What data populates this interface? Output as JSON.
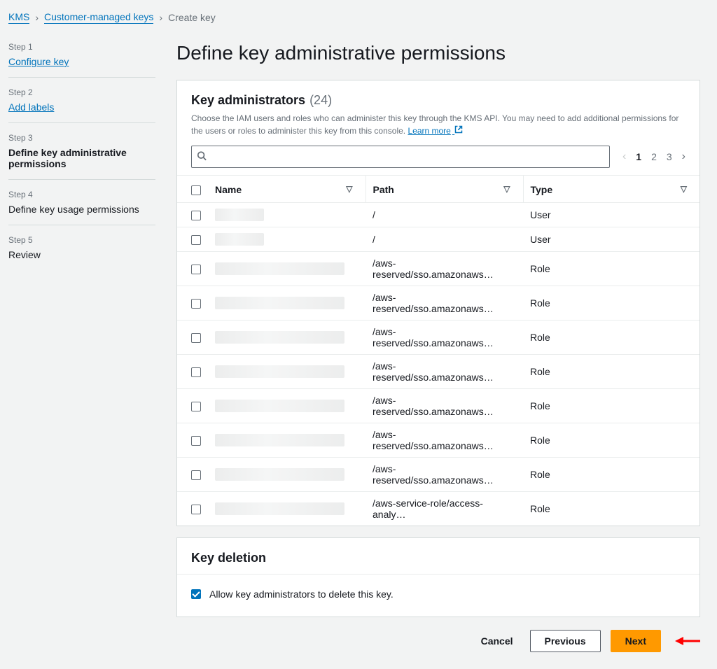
{
  "breadcrumbs": {
    "items": [
      {
        "label": "KMS",
        "link": true
      },
      {
        "label": "Customer-managed keys",
        "link": true
      },
      {
        "label": "Create key",
        "link": false
      }
    ]
  },
  "wizard_steps": [
    {
      "step": "Step 1",
      "title": "Configure key",
      "state": "link"
    },
    {
      "step": "Step 2",
      "title": "Add labels",
      "state": "link"
    },
    {
      "step": "Step 3",
      "title": "Define key administrative permissions",
      "state": "current"
    },
    {
      "step": "Step 4",
      "title": "Define key usage permissions",
      "state": "future"
    },
    {
      "step": "Step 5",
      "title": "Review",
      "state": "future"
    }
  ],
  "page_title": "Define key administrative permissions",
  "admins_panel": {
    "title": "Key administrators",
    "count": "(24)",
    "description": "Choose the IAM users and roles who can administer this key through the KMS API. You may need to add additional permissions for the users or roles to administer this key from this console.",
    "learn_more": "Learn more",
    "search_placeholder": "",
    "pagination": {
      "pages": [
        "1",
        "2",
        "3"
      ],
      "current": "1"
    },
    "columns": {
      "name": "Name",
      "path": "Path",
      "type": "Type"
    },
    "rows": [
      {
        "name_blur": "s",
        "path": "/",
        "type": "User"
      },
      {
        "name_blur": "s",
        "path": "/",
        "type": "User"
      },
      {
        "name_blur": "l",
        "path": "/aws-reserved/sso.amazonaws…",
        "type": "Role"
      },
      {
        "name_blur": "l",
        "path": "/aws-reserved/sso.amazonaws…",
        "type": "Role"
      },
      {
        "name_blur": "l",
        "path": "/aws-reserved/sso.amazonaws…",
        "type": "Role"
      },
      {
        "name_blur": "l",
        "path": "/aws-reserved/sso.amazonaws…",
        "type": "Role"
      },
      {
        "name_blur": "l",
        "path": "/aws-reserved/sso.amazonaws…",
        "type": "Role"
      },
      {
        "name_blur": "l",
        "path": "/aws-reserved/sso.amazonaws…",
        "type": "Role"
      },
      {
        "name_blur": "l",
        "path": "/aws-reserved/sso.amazonaws…",
        "type": "Role"
      },
      {
        "name_blur": "l",
        "path": "/aws-service-role/access-analy…",
        "type": "Role"
      }
    ]
  },
  "deletion_panel": {
    "title": "Key deletion",
    "checkbox_label": "Allow key administrators to delete this key.",
    "checked": true
  },
  "footer": {
    "cancel": "Cancel",
    "previous": "Previous",
    "next": "Next"
  }
}
